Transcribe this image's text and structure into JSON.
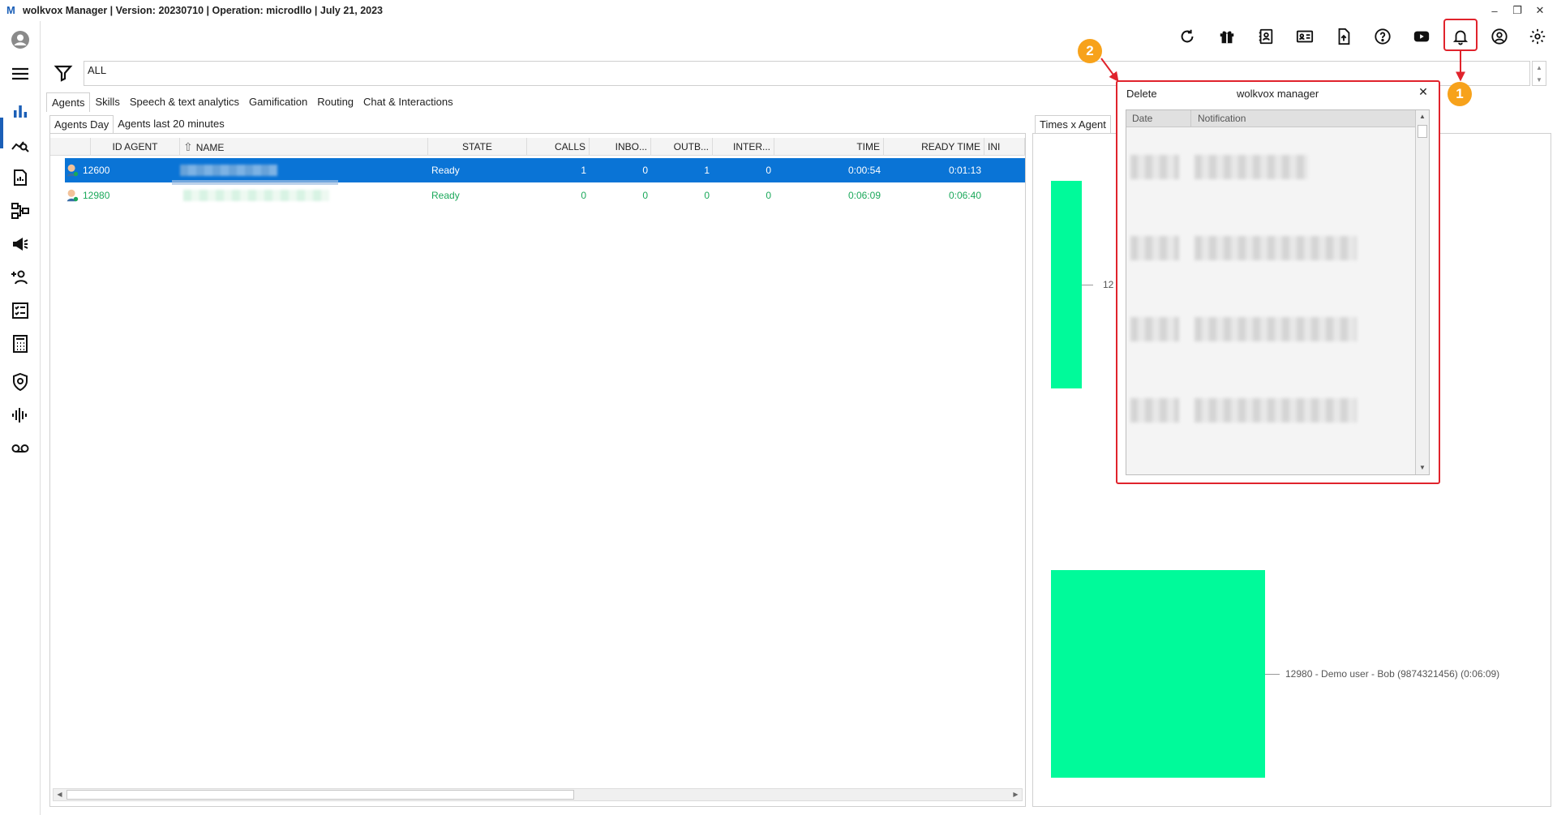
{
  "window": {
    "title": "wolkvox Manager  | Version: 20230710 |  Operation: microdllo | July 21, 2023",
    "minimize": "–",
    "restore": "❐",
    "close": "✕"
  },
  "toolbar": {
    "icons": [
      "refresh-icon",
      "gift-icon",
      "contacts-book-icon",
      "id-card-icon",
      "file-upload-icon",
      "help-icon",
      "youtube-icon",
      "bell-icon",
      "user-circle-icon",
      "gear-icon"
    ]
  },
  "rail": {
    "icons": [
      "avatar",
      "menu-icon",
      "bar-chart-icon",
      "chart-search-icon",
      "report-icon",
      "routing-icon",
      "campaign-icon",
      "add-users-icon",
      "checklist-icon",
      "calculator-icon",
      "security-icon",
      "audio-wave-icon",
      "voicemail-icon"
    ]
  },
  "filter": {
    "value": "ALL"
  },
  "tabs": [
    "Agents",
    "Skills",
    "Speech & text analytics",
    "Gamification",
    "Routing",
    "Chat & Interactions"
  ],
  "subtabs": [
    "Agents Day",
    "Agents last 20 minutes"
  ],
  "grid": {
    "columns": [
      "ID AGENT",
      "NAME",
      "STATE",
      "CALLS",
      "INBO...",
      "OUTB...",
      "INTER...",
      "TIME",
      "READY TIME",
      "INI"
    ],
    "sort_icon": "⇧",
    "rows": [
      {
        "id": "12600",
        "state": "Ready",
        "calls": "1",
        "inbound": "0",
        "outbound": "1",
        "internal": "0",
        "time": "0:00:54",
        "ready_time": "0:01:13"
      },
      {
        "id": "12980",
        "state": "Ready",
        "calls": "0",
        "inbound": "0",
        "outbound": "0",
        "internal": "0",
        "time": "0:06:09",
        "ready_time": "0:06:40"
      }
    ]
  },
  "chart": {
    "tab": "Times x Agent",
    "label_partial": "12",
    "label_full": "12980 - Demo user - Bob (9874321456) (0:06:09)",
    "color": "#00fa9a"
  },
  "popup": {
    "delete": "Delete",
    "title": "wolkvox manager",
    "close": "✕",
    "columns": [
      "Date",
      "Notification"
    ],
    "border_color": "#e0232c"
  },
  "callouts": [
    "1",
    "2"
  ]
}
